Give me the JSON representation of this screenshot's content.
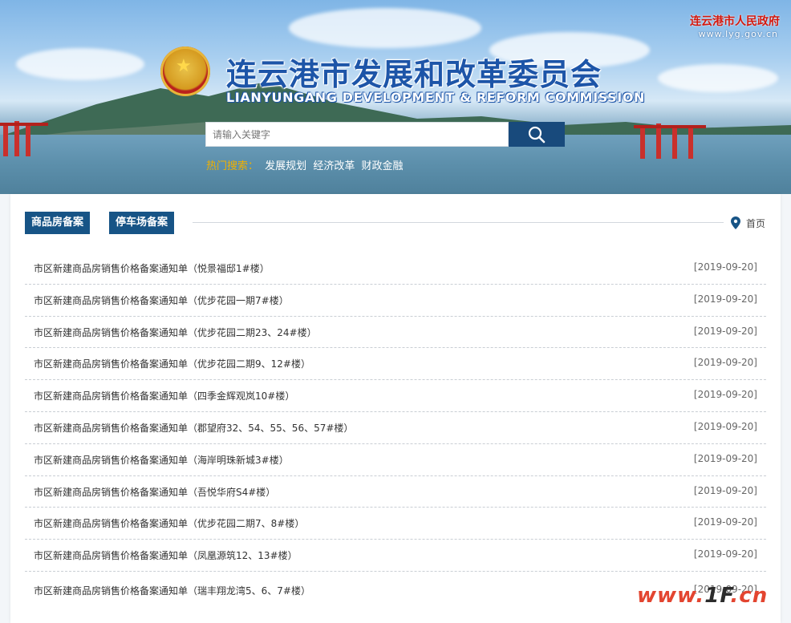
{
  "header": {
    "title": "连云港市发展和改革委员会",
    "subtitle": "LIANYUNGANG DEVELOPMENT & REFORM COMMISSION",
    "gov_name": "连云港市人民政府",
    "gov_url": "www.lyg.gov.cn"
  },
  "search": {
    "placeholder": "请输入关键字",
    "button_icon": "search-icon",
    "hot_label": "热门搜索：",
    "hot_words": [
      "发展规划",
      "经济改革",
      "财政金融"
    ]
  },
  "tabs": [
    "商品房备案",
    "停车场备案"
  ],
  "breadcrumb": {
    "home_icon": "location-pin-icon",
    "home_label": "首页"
  },
  "list": [
    {
      "title": "市区新建商品房销售价格备案通知单（悦景福邸1#楼）",
      "date": "[2019-09-20]"
    },
    {
      "title": "市区新建商品房销售价格备案通知单（优步花园一期7#楼）",
      "date": "[2019-09-20]"
    },
    {
      "title": "市区新建商品房销售价格备案通知单（优步花园二期23、24#楼）",
      "date": "[2019-09-20]"
    },
    {
      "title": "市区新建商品房销售价格备案通知单（优步花园二期9、12#楼）",
      "date": "[2019-09-20]"
    },
    {
      "title": "市区新建商品房销售价格备案通知单（四季金辉观岚10#楼）",
      "date": "[2019-09-20]"
    },
    {
      "title": "市区新建商品房销售价格备案通知单（郡望府32、54、55、56、57#楼）",
      "date": "[2019-09-20]"
    },
    {
      "title": "市区新建商品房销售价格备案通知单（海岸明珠新城3#楼）",
      "date": "[2019-09-20]"
    },
    {
      "title": "市区新建商品房销售价格备案通知单（吾悦华府S4#楼）",
      "date": "[2019-09-20]"
    },
    {
      "title": "市区新建商品房销售价格备案通知单（优步花园二期7、8#楼）",
      "date": "[2019-09-20]"
    },
    {
      "title": "市区新建商品房销售价格备案通知单（凤凰源筑12、13#楼）",
      "date": "[2019-09-20]"
    },
    {
      "title": "市区新建商品房销售价格备案通知单（瑞丰翔龙湾5、6、7#楼）",
      "date": "[2019-09-20]"
    }
  ],
  "watermark": {
    "text_main": "www.",
    "text_hi": "1F",
    "text_tail": ".cn"
  },
  "colors": {
    "brand_blue": "#175486",
    "title_blue": "#1d55a8",
    "gov_red": "#d3180e",
    "hot_label": "#f0b000"
  }
}
